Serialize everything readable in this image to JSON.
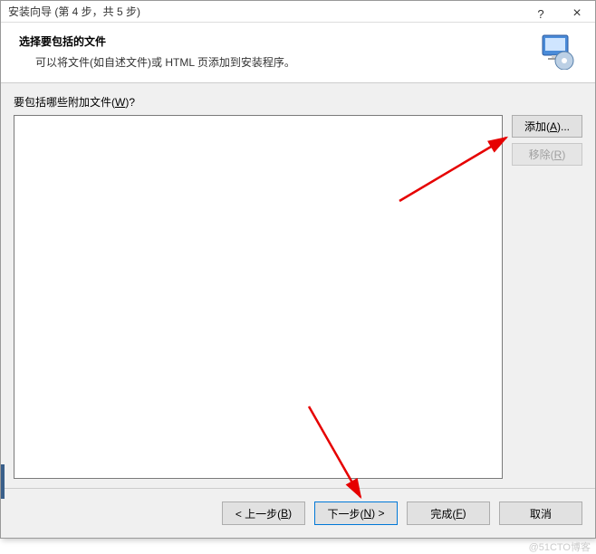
{
  "titlebar": {
    "title": "安装向导 (第 4 步，共 5 步)",
    "help_label": "?",
    "close_label": "×"
  },
  "header": {
    "title": "选择要包括的文件",
    "description": "可以将文件(如自述文件)或 HTML 页添加到安装程序。"
  },
  "field": {
    "label_prefix": "要包括哪些附加文件(",
    "label_mnemonic": "W",
    "label_suffix": ")?"
  },
  "side": {
    "add_prefix": "添加(",
    "add_mnemonic": "A",
    "add_suffix": ")...",
    "remove_prefix": "移除(",
    "remove_mnemonic": "R",
    "remove_suffix": ")"
  },
  "footer": {
    "back_prefix": "< 上一步(",
    "back_mnemonic": "B",
    "back_suffix": ")",
    "next_prefix": "下一步(",
    "next_mnemonic": "N",
    "next_suffix": ") >",
    "finish_prefix": "完成(",
    "finish_mnemonic": "F",
    "finish_suffix": ")",
    "cancel": "取消"
  },
  "watermark": "@51CTO博客"
}
